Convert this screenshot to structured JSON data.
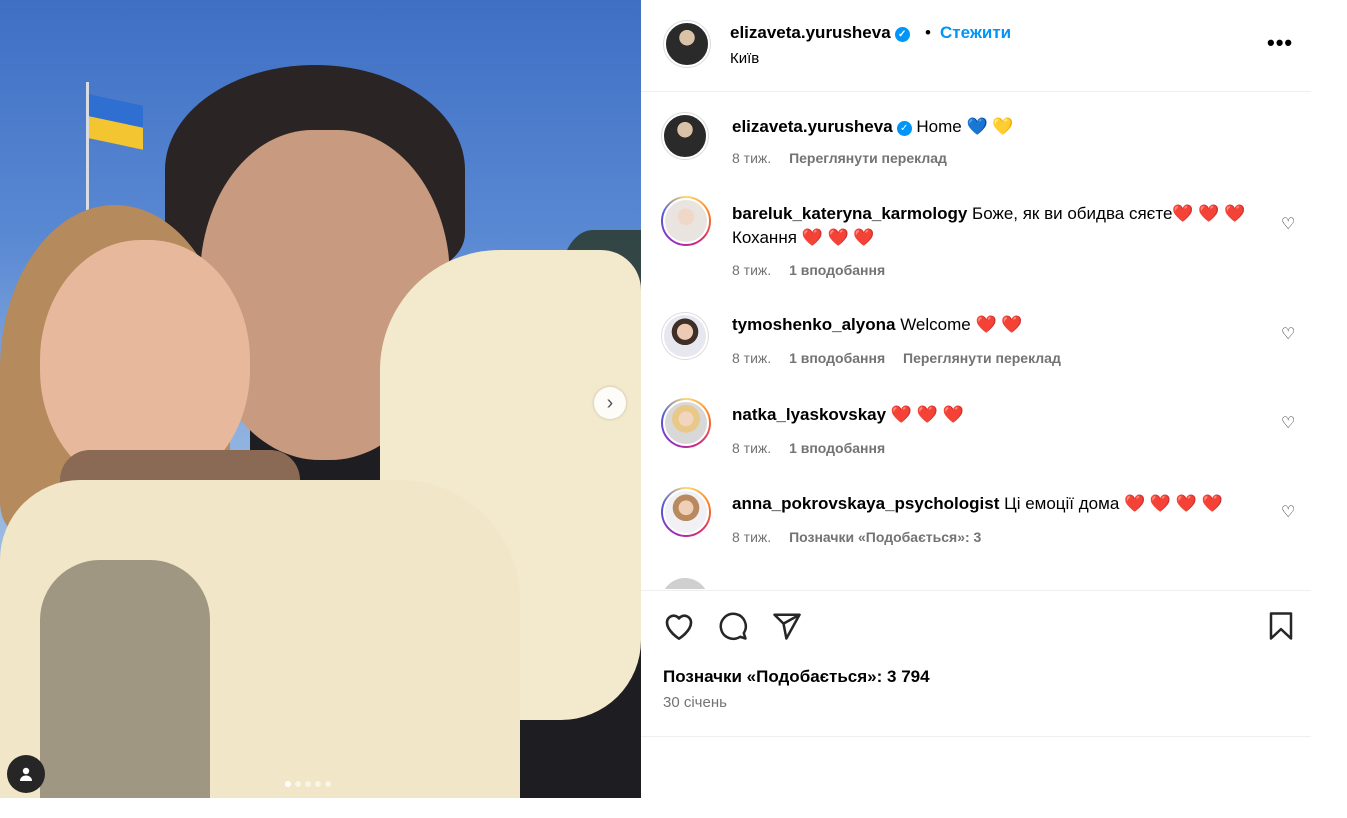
{
  "post": {
    "author": "elizaveta.yurusheva",
    "follow_label": "Стежити",
    "separator": "•",
    "location": "Київ",
    "more_label": "•••",
    "caption_text": "Home",
    "caption_emoji": "💙 💛",
    "caption_time": "8 тиж.",
    "caption_translate": "Переглянути переклад",
    "likes_label": "Позначки «Подобається»: 3 794",
    "date": "30 січень"
  },
  "comments": [
    {
      "user": "bareluk_kateryna_karmology",
      "text": "Боже, як ви обидва сяєте",
      "emoji": "❤️ ❤️ ❤️",
      "text2": "Кохання",
      "emoji2": "❤️ ❤️ ❤️",
      "time": "8 тиж.",
      "likes": "1 вподобання",
      "extra": ""
    },
    {
      "user": "tymoshenko_alyona",
      "text": "Welcome",
      "emoji": "❤️ ❤️",
      "time": "8 тиж.",
      "likes": "1 вподобання",
      "extra": "Переглянути переклад"
    },
    {
      "user": "natka_lyaskovskay",
      "text": "",
      "emoji": "❤️ ❤️ ❤️",
      "time": "8 тиж.",
      "likes": "1 вподобання",
      "extra": ""
    },
    {
      "user": "anna_pokrovskaya_psychologist",
      "text": "Ці емоції дома",
      "emoji": "❤️ ❤️ ❤️ ❤️",
      "time": "8 тиж.",
      "likes": "Позначки «Подобається»: 3",
      "extra": ""
    }
  ],
  "icons": {
    "verified": "verified-badge-icon",
    "heart": "heart-icon",
    "comment": "comment-icon",
    "share": "share-icon",
    "save": "bookmark-icon",
    "next": "chevron-right-icon",
    "tag": "user-tag-icon"
  },
  "carousel": {
    "count": 5,
    "active": 0
  },
  "colors": {
    "accent": "#0095f6",
    "muted": "#737373",
    "border": "#efefef"
  }
}
